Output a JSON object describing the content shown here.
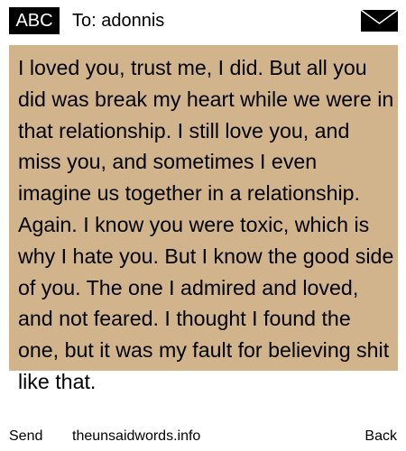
{
  "header": {
    "mode_badge": "ABC",
    "to_label": "To: adonnis",
    "envelope_icon": "envelope-icon"
  },
  "message": {
    "body": "I loved you, trust me, I did. But all you did was break my heart while we were in that relationship. I still love you, and miss you, and sometimes I even imagine us together in a relationship. Again. I know you were toxic, which is why I hate you. But I know the good side of you. The one I admired and loved, and not feared. I thought I found the one, but it was my fault for believing shit like that.",
    "background_color": "#d2b48c"
  },
  "softkeys": {
    "left_label": "Send",
    "center_label": "theunsaidwords.info",
    "right_label": "Back"
  }
}
